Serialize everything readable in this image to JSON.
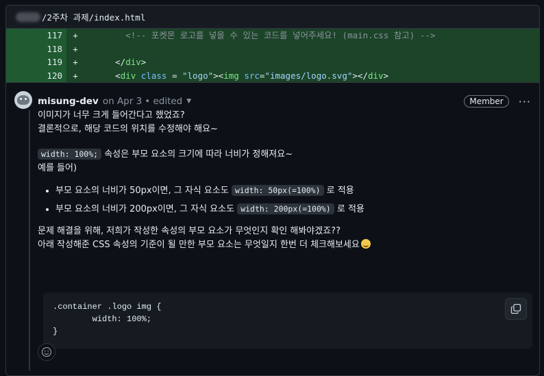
{
  "file": {
    "path": "/2주차 과제/index.html"
  },
  "diff_lines": [
    {
      "num": "117",
      "sign": "+",
      "parts": [
        {
          "cls": "c-plain",
          "t": "        "
        },
        {
          "cls": "c-comment",
          "t": "<!-- 포켓몬 로고를 넣을 수 있는 코드를 넣어주세요! (main.css 참고) -->"
        }
      ]
    },
    {
      "num": "118",
      "sign": "+",
      "parts": [
        {
          "cls": "c-plain",
          "t": ""
        }
      ]
    },
    {
      "num": "119",
      "sign": "+",
      "parts": [
        {
          "cls": "c-plain",
          "t": "      </"
        },
        {
          "cls": "c-tag",
          "t": "div"
        },
        {
          "cls": "c-plain",
          "t": ">"
        }
      ]
    },
    {
      "num": "120",
      "sign": "+",
      "parts": [
        {
          "cls": "c-plain",
          "t": "      <"
        },
        {
          "cls": "c-tag",
          "t": "div"
        },
        {
          "cls": "c-attr",
          "t": " class"
        },
        {
          "cls": "c-plain",
          "t": " = "
        },
        {
          "cls": "c-str",
          "t": "\"logo\""
        },
        {
          "cls": "c-plain",
          "t": "><"
        },
        {
          "cls": "c-tag",
          "t": "img"
        },
        {
          "cls": "c-attr",
          "t": " src"
        },
        {
          "cls": "c-plain",
          "t": "="
        },
        {
          "cls": "c-str",
          "t": "\"images/logo.svg\""
        },
        {
          "cls": "c-plain",
          "t": "></"
        },
        {
          "cls": "c-tag",
          "t": "div"
        },
        {
          "cls": "c-plain",
          "t": ">"
        }
      ]
    }
  ],
  "comment": {
    "author": "misung-dev",
    "date": "on Apr 3",
    "edited": "• edited",
    "badge": "Member",
    "menu": "···",
    "line1": "이미지가 너무 크게 들어간다고 했었죠?",
    "line2": "결론적으로, 해당 코드의 위치를 수정해야 해요~",
    "width_code": "width: 100%;",
    "width_text": " 속성은 부모 요소의 크기에 따라 너비가 정해져요~",
    "example": "예를 들어)",
    "bullet1_text": "부모 요소의 너비가 50px이면, 그 자식 요소도 ",
    "bullet1_code": "width: 50px(=100%)",
    "bullet1_tail": " 로 적용",
    "bullet2_text": "부모 요소의 너비가 200px이면, 그 자식 요소도 ",
    "bullet2_code": "width: 200px(=100%)",
    "bullet2_tail": " 로 적용",
    "para3_line1": "문제 해결을 위해, 저희가 작성한 속성의 부모 요소가 무엇인지 확인 해봐야겠죠??",
    "para3_line2": "아래 작성해준 CSS 속성의 기준이 될 만한 부모 요소는 무엇일지 한번 더 체크해보세요",
    "code_block": ".container .logo img {\n        width: 100%;\n}"
  },
  "icons": {
    "copy": "copy-icon",
    "smiley": "smiley-icon",
    "caret": "chevron-down-icon",
    "kebab": "kebab-horizontal-icon"
  }
}
